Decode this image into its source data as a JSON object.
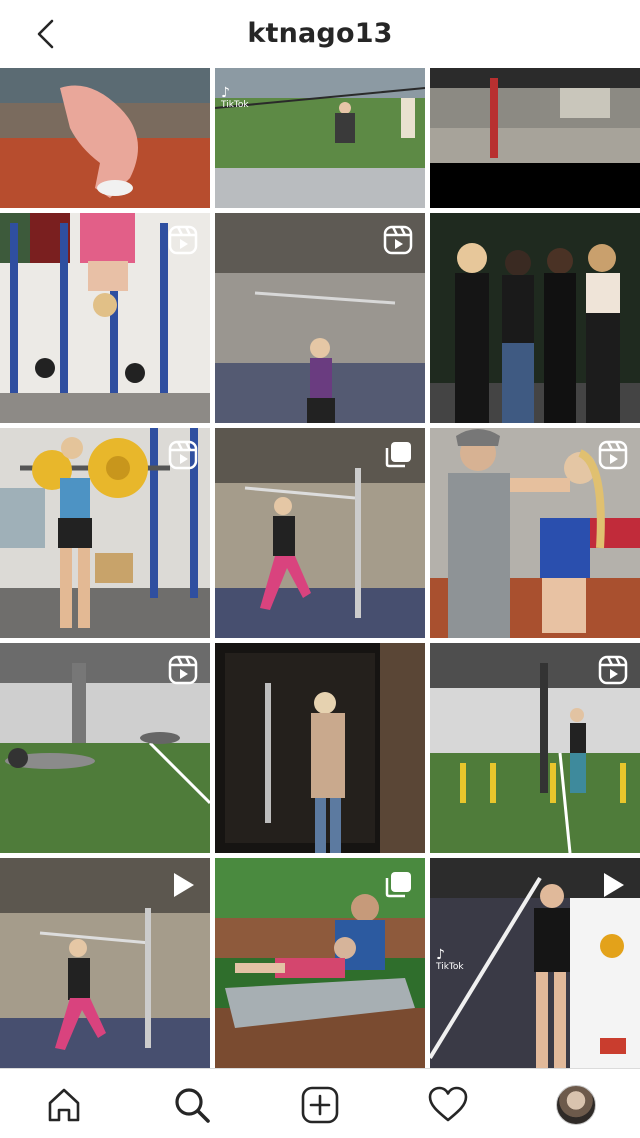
{
  "header": {
    "back_icon": "chevron-left-icon",
    "title": "ktnago13"
  },
  "grid": {
    "tiles": [
      {
        "row": 1,
        "col": 1,
        "badge": "none",
        "desc": "athlete crouching in pink on track"
      },
      {
        "row": 1,
        "col": 2,
        "badge": "none",
        "watermark": "TikTok",
        "desc": "pole vault on outdoor field"
      },
      {
        "row": 1,
        "col": 3,
        "badge": "none",
        "desc": "indoor pole vault facility"
      },
      {
        "row": 2,
        "col": 1,
        "badge": "reels",
        "desc": "inverted hanging on gym rack"
      },
      {
        "row": 2,
        "col": 2,
        "badge": "reels",
        "desc": "pole vault drill indoors"
      },
      {
        "row": 2,
        "col": 3,
        "badge": "none",
        "desc": "four friends posing at night"
      },
      {
        "row": 3,
        "col": 1,
        "badge": "reels",
        "desc": "barbell squat in gym"
      },
      {
        "row": 3,
        "col": 2,
        "badge": "carousel",
        "desc": "pole vault runway drill"
      },
      {
        "row": 3,
        "col": 3,
        "badge": "reels",
        "desc": "couple hugging at track meet"
      },
      {
        "row": 4,
        "col": 1,
        "badge": "reels",
        "desc": "core exercise on turf"
      },
      {
        "row": 4,
        "col": 2,
        "badge": "none",
        "desc": "woman opening glass door"
      },
      {
        "row": 4,
        "col": 3,
        "badge": "reels",
        "desc": "hurdle drills on turf"
      },
      {
        "row": 5,
        "col": 1,
        "badge": "video",
        "desc": "pole vault takeoff drill"
      },
      {
        "row": 5,
        "col": 2,
        "badge": "carousel",
        "desc": "couple on deck lounge chair"
      },
      {
        "row": 5,
        "col": 3,
        "badge": "video",
        "watermark": "TikTok",
        "desc": "athlete holding vault pole"
      }
    ]
  },
  "bottom_nav": {
    "items": [
      "home-icon",
      "search-icon",
      "new-post-icon",
      "activity-heart-icon",
      "profile-avatar"
    ]
  },
  "colors": {
    "header_text": "#262626",
    "divider": "#dbdbdb",
    "background": "#ffffff"
  }
}
